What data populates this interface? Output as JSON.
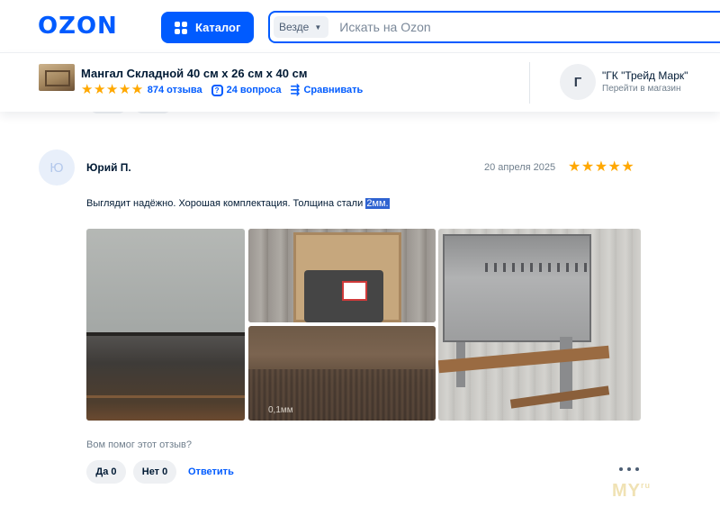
{
  "header": {
    "logo": "OZON",
    "catalog_label": "Каталог",
    "search_scope": "Везде",
    "search_placeholder": "Искать на Ozon"
  },
  "product": {
    "title": "Мангал Складной 40 см х 26 см х 40 см",
    "rating_stars": 5,
    "reviews_label": "874 отзыва",
    "questions_label": "24 вопроса",
    "compare_label": "Сравнивать"
  },
  "seller": {
    "avatar_letter": "Г",
    "name": "\"ГК \"Трейд Марк\"",
    "link": "Перейти в магазин"
  },
  "review": {
    "avatar_letter": "Ю",
    "author": "Юрий П.",
    "date": "20 апреля 2025",
    "stars": 5,
    "text": "Выглядит надёжно. Хорошая комплектация. Толщина стали ",
    "text_highlight": "2мм.",
    "photo_label": "0,1мм",
    "helpful_question": "Вом помог этот отзыв?",
    "yes_label": "Да 0",
    "no_label": "Нет 0",
    "reply_label": "Ответить"
  },
  "watermark": {
    "text": "MY",
    "suffix": "ru"
  },
  "colors": {
    "accent": "#005bff",
    "star": "#ffa800",
    "text": "#001a34",
    "muted": "#707f8d"
  },
  "icons": {
    "catalog": "grid-icon",
    "scope_dropdown": "chevron-down-icon",
    "questions": "question-icon",
    "compare": "compare-icon",
    "more": "more-dots-icon"
  }
}
